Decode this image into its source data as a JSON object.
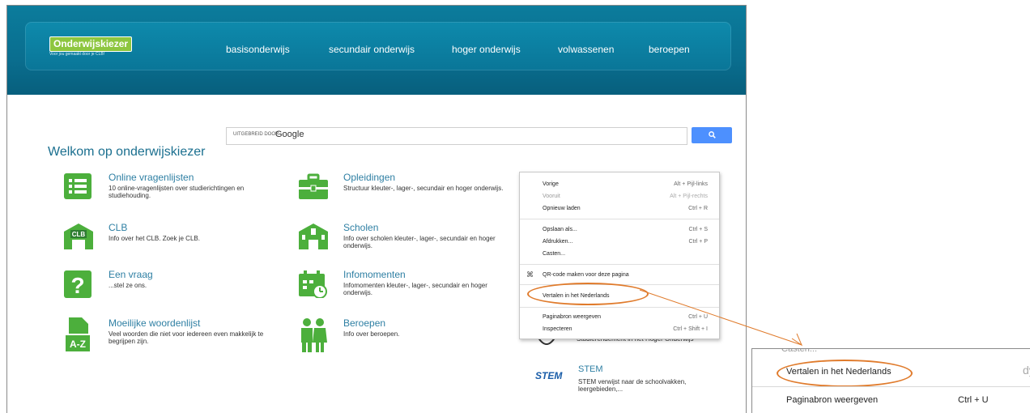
{
  "header": {
    "logo": {
      "name": "Onderwijskiezer",
      "tagline": "Voor jou gemaakt door je CLB!"
    },
    "nav": [
      "basisonderwijs",
      "secundair onderwijs",
      "hoger onderwijs",
      "volwassenen",
      "beroepen"
    ]
  },
  "search": {
    "powered_by": "UITGEBREID DOOR",
    "brand": "Google",
    "button_icon": "search-icon"
  },
  "welcome": "Welkom op onderwijskiezer",
  "tiles": [
    {
      "title": "Online vragenlijsten",
      "desc": "10 online-vragenlijsten over studierichtingen en studiehouding."
    },
    {
      "title": "Opleidingen",
      "desc": "Structuur kleuter-, lager-, secundair en hoger onderwijs."
    },
    {
      "title": "CLB",
      "desc": "Info over het CLB. Zoek je CLB."
    },
    {
      "title": "Scholen",
      "desc": "Info over scholen kleuter-, lager-, secundair en hoger onderwijs."
    },
    {
      "title": "Een vraag",
      "desc": "...stel ze ons."
    },
    {
      "title": "Infomomenten",
      "desc": "Infomomenten kleuter-, lager-, secundair en hoger onderwijs."
    },
    {
      "title": "Moeilijke woordenlijst",
      "desc": "Veel woorden die niet voor iedereen even makkelijk te begrijpen zijn."
    },
    {
      "title": "Beroepen",
      "desc": "Info over beroepen."
    }
  ],
  "partial_tile_text": "Studierendement in het Hoger Onderwijs",
  "stem": {
    "logo": "STEM",
    "title": "STEM",
    "desc": "STEM verwijst naar de schoolvakken, leergebieden,..."
  },
  "context_menu": {
    "items": [
      {
        "label": "Vorige",
        "shortcut": "Alt + Pijl-links"
      },
      {
        "label": "Vooruit",
        "shortcut": "Alt + Pijl-rechts"
      },
      {
        "label": "Opnieuw laden",
        "shortcut": "Ctrl + R"
      },
      {
        "label": "Opslaan als...",
        "shortcut": "Ctrl + S"
      },
      {
        "label": "Afdrukken...",
        "shortcut": "Ctrl + P"
      },
      {
        "label": "Casten...",
        "shortcut": ""
      },
      {
        "label": "QR-code maken voor deze pagina",
        "shortcut": ""
      },
      {
        "label": "Vertalen in het Nederlands",
        "shortcut": ""
      },
      {
        "label": "Paginabron weergeven",
        "shortcut": "Ctrl + U"
      },
      {
        "label": "Inspecteren",
        "shortcut": "Ctrl + Shift + I"
      }
    ]
  },
  "zoom": {
    "highlight_label": "Vertalen in het Nederlands",
    "next_label": "Paginabron weergeven",
    "next_shortcut": "Ctrl + U"
  },
  "colors": {
    "header": "#0a6e8f",
    "accent_green": "#8dc63f",
    "highlight": "#e07b2c",
    "search_button": "#4d90fe"
  }
}
